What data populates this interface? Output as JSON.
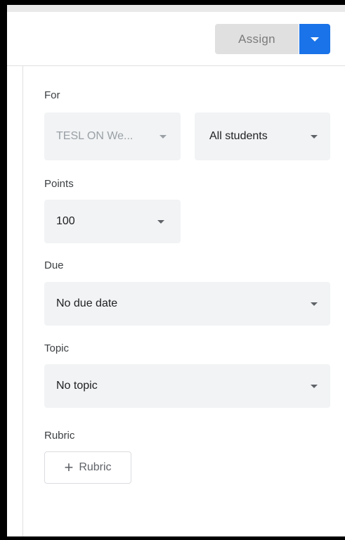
{
  "header": {
    "assign_label": "Assign"
  },
  "for": {
    "label": "For",
    "class_value": "TESL ON We...",
    "students_value": "All students"
  },
  "points": {
    "label": "Points",
    "value": "100"
  },
  "due": {
    "label": "Due",
    "value": "No due date"
  },
  "topic": {
    "label": "Topic",
    "value": "No topic"
  },
  "rubric": {
    "label": "Rubric",
    "button_label": "Rubric",
    "button_icon": "plus-icon"
  },
  "colors": {
    "accent": "#1a73e8",
    "field_bg": "#f1f3f4",
    "disabled_button": "#e0e0e0"
  }
}
